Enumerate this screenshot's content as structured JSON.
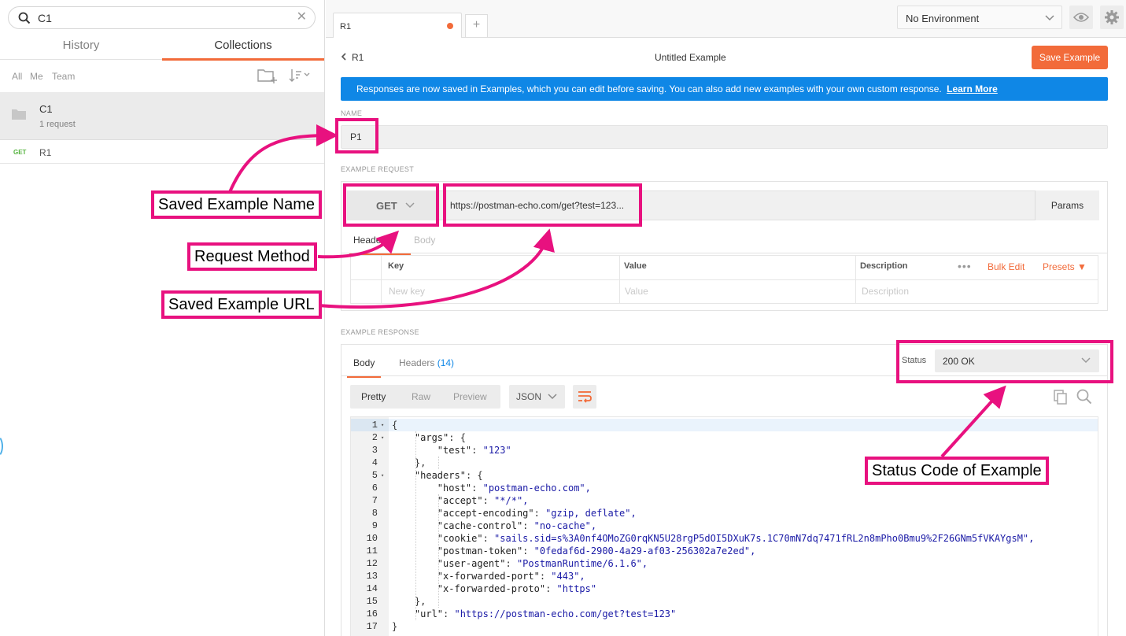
{
  "sidebar": {
    "search_value": "C1",
    "tabs": {
      "history": "History",
      "collections": "Collections"
    },
    "filters": {
      "all": "All",
      "me": "Me",
      "team": "Team"
    },
    "collection": {
      "name": "C1",
      "count": "1 request"
    },
    "request": {
      "method": "GET",
      "name": "R1"
    }
  },
  "topbar": {
    "tab_label": "R1",
    "add_tab": "+",
    "environment": "No Environment",
    "accent": "#f26b3a"
  },
  "example": {
    "back_label": "R1",
    "title": "Untitled Example",
    "save_label": "Save Example",
    "banner_text": "Responses are now saved in Examples, which you can edit before saving. You can also add new examples with your own custom response.",
    "banner_link": "Learn More",
    "banner_color": "#0f87e6",
    "name_label": "NAME",
    "name_value": "P1"
  },
  "request": {
    "section_label": "EXAMPLE REQUEST",
    "method": "GET",
    "url": "https://postman-echo.com/get?test=123...",
    "params_label": "Params",
    "tabs": {
      "headers": "Headers",
      "body": "Body"
    },
    "columns": {
      "key": "Key",
      "value": "Value",
      "description": "Description"
    },
    "placeholders": {
      "key": "New key",
      "value": "Value",
      "description": "Description"
    },
    "more": "•••",
    "bulk_edit": "Bulk Edit",
    "presets": "Presets ▼"
  },
  "response": {
    "section_label": "EXAMPLE RESPONSE",
    "tabs": {
      "body": "Body",
      "headers": "Headers",
      "headers_count": "(14)"
    },
    "status_label": "Status",
    "status_value": "200 OK",
    "views": {
      "pretty": "Pretty",
      "raw": "Raw",
      "preview": "Preview"
    },
    "language": "JSON",
    "lines": [
      {
        "n": "1",
        "fold": true,
        "indent": 0,
        "key": "",
        "value": "",
        "text": "{"
      },
      {
        "n": "2",
        "fold": true,
        "indent": 1,
        "key": "\"args\"",
        "value": "",
        "text": ": {"
      },
      {
        "n": "3",
        "fold": false,
        "indent": 2,
        "key": "\"test\"",
        "value": "\"123\"",
        "text": ": "
      },
      {
        "n": "4",
        "fold": false,
        "indent": 1,
        "key": "",
        "value": "",
        "text": "},"
      },
      {
        "n": "5",
        "fold": true,
        "indent": 1,
        "key": "\"headers\"",
        "value": "",
        "text": ": {"
      },
      {
        "n": "6",
        "fold": false,
        "indent": 2,
        "key": "\"host\"",
        "value": "\"postman-echo.com\",",
        "text": ": "
      },
      {
        "n": "7",
        "fold": false,
        "indent": 2,
        "key": "\"accept\"",
        "value": "\"*/*\",",
        "text": ": "
      },
      {
        "n": "8",
        "fold": false,
        "indent": 2,
        "key": "\"accept-encoding\"",
        "value": "\"gzip, deflate\",",
        "text": ": "
      },
      {
        "n": "9",
        "fold": false,
        "indent": 2,
        "key": "\"cache-control\"",
        "value": "\"no-cache\",",
        "text": ": "
      },
      {
        "n": "10",
        "fold": false,
        "indent": 2,
        "key": "\"cookie\"",
        "value": "\"sails.sid=s%3A0nf4OMoZG0rqKN5U28rgP5dOI5DXuK7s.1C70mN7dq7471fRL2n8mPho0Bmu9%2F26GNm5fVKAYgsM\",",
        "text": ": "
      },
      {
        "n": "11",
        "fold": false,
        "indent": 2,
        "key": "\"postman-token\"",
        "value": "\"0fedaf6d-2900-4a29-af03-256302a7e2ed\",",
        "text": ": "
      },
      {
        "n": "12",
        "fold": false,
        "indent": 2,
        "key": "\"user-agent\"",
        "value": "\"PostmanRuntime/6.1.6\",",
        "text": ": "
      },
      {
        "n": "13",
        "fold": false,
        "indent": 2,
        "key": "\"x-forwarded-port\"",
        "value": "\"443\",",
        "text": ": "
      },
      {
        "n": "14",
        "fold": false,
        "indent": 2,
        "key": "\"x-forwarded-proto\"",
        "value": "\"https\"",
        "text": ": "
      },
      {
        "n": "15",
        "fold": false,
        "indent": 1,
        "key": "",
        "value": "",
        "text": "},"
      },
      {
        "n": "16",
        "fold": false,
        "indent": 1,
        "key": "\"url\"",
        "value": "\"https://postman-echo.com/get?test=123\"",
        "text": ": "
      },
      {
        "n": "17",
        "fold": false,
        "indent": 0,
        "key": "",
        "value": "",
        "text": "}"
      }
    ]
  },
  "annotations": {
    "name": "Saved Example Name",
    "method": "Request Method",
    "url": "Saved Example URL",
    "status": "Status Code of Example",
    "color": "#e8117f"
  }
}
